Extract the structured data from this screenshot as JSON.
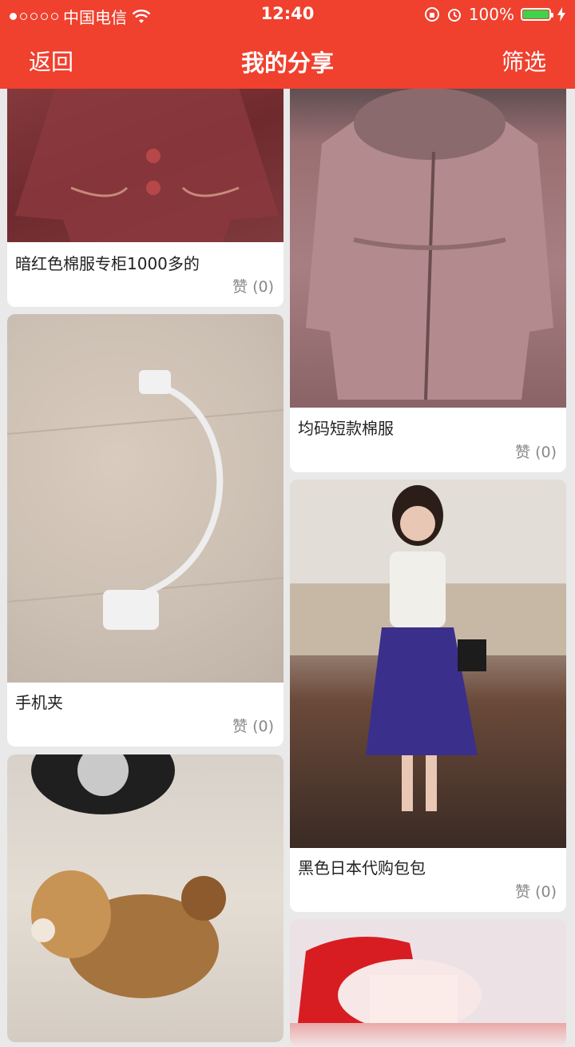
{
  "status_bar": {
    "carrier": "中国电信",
    "time": "12:40",
    "battery": "100%",
    "battery_level": 1.0
  },
  "nav": {
    "back_label": "返回",
    "title": "我的分享",
    "filter_label": "筛选"
  },
  "items": [
    {
      "caption": "暗红色棉服专柜1000多的",
      "likes": "赞 (0)"
    },
    {
      "caption": "均码短款棉服",
      "likes": "赞 (0)"
    },
    {
      "caption": "手机夹",
      "likes": "赞 (0)"
    },
    {
      "caption": "黑色日本代购包包",
      "likes": "赞 (0)"
    },
    {
      "caption": "",
      "likes": ""
    },
    {
      "caption": "",
      "likes": ""
    }
  ],
  "colors": {
    "header": "#f0402e",
    "background": "#e9e9e9",
    "battery_fill": "#3ed34a"
  }
}
